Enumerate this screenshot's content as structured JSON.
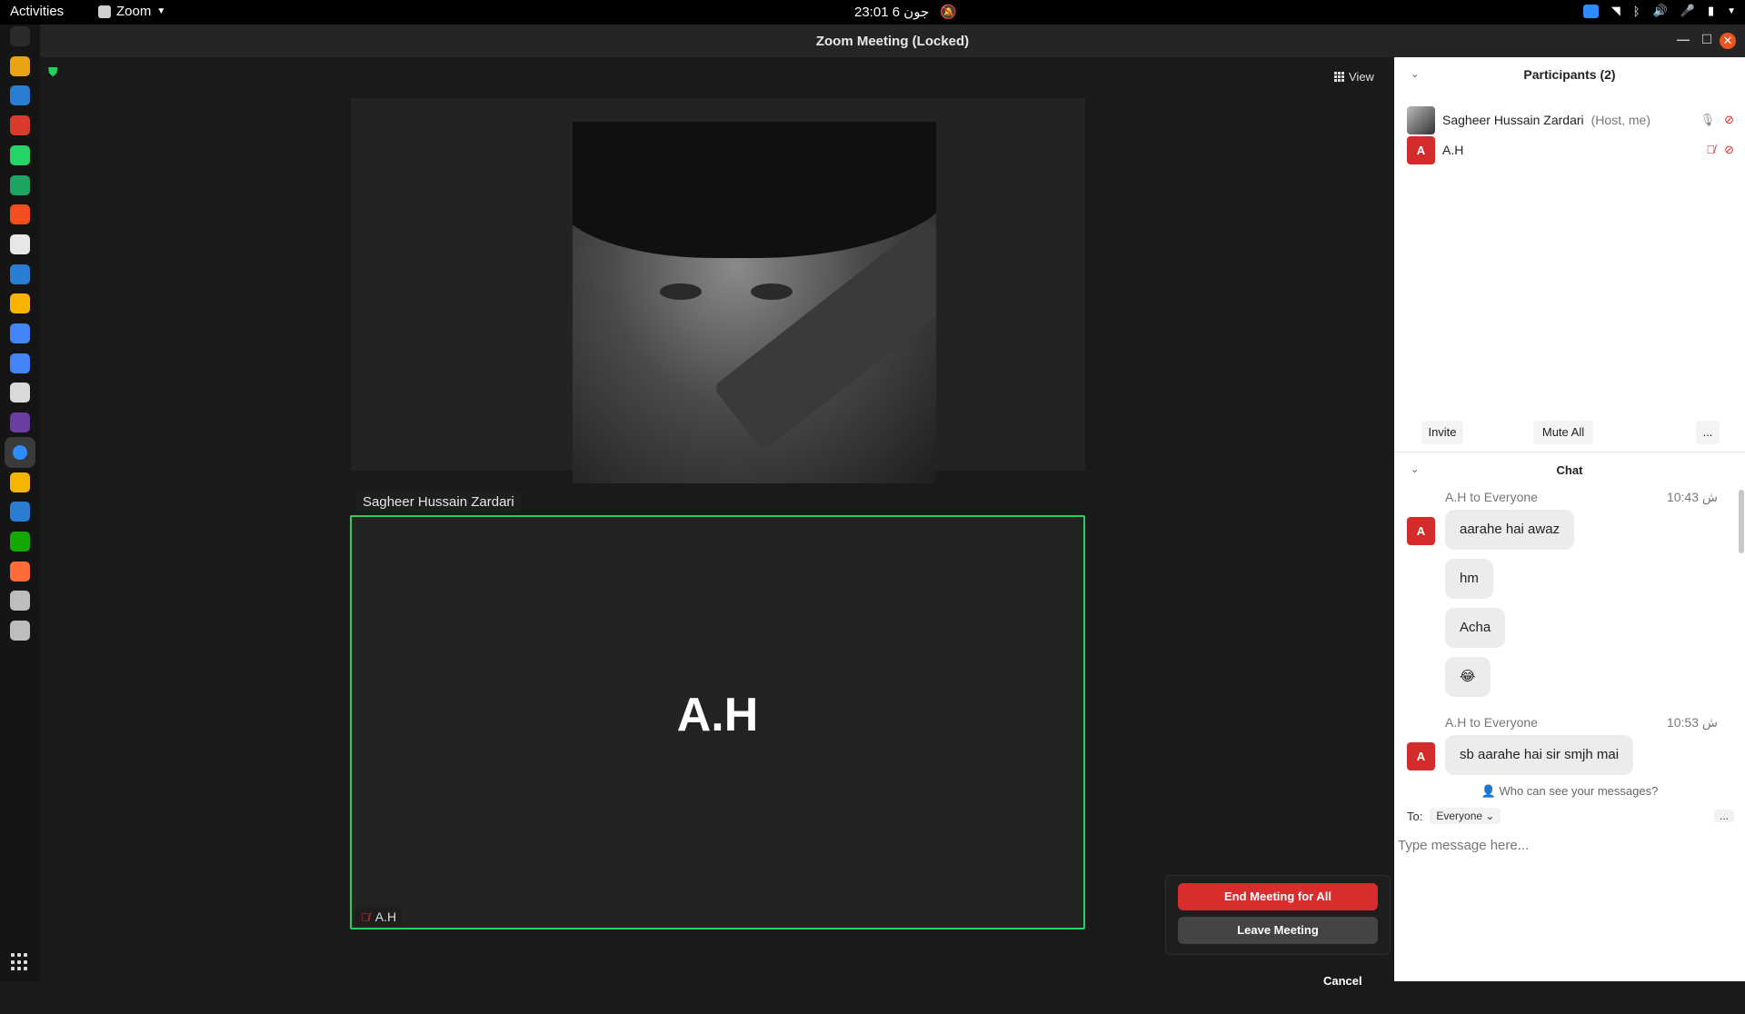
{
  "topbar": {
    "activities": "Activities",
    "app_name": "Zoom",
    "clock": "23:01  6 جون",
    "zoom_tray_icon": "zoom-tray-icon",
    "tray_icons": [
      "wifi-icon",
      "bluetooth-icon",
      "volume-icon",
      "mic-icon",
      "battery-icon",
      "chevron-down-icon"
    ]
  },
  "dock": {
    "apps": [
      {
        "name": "terminal",
        "color": "#2b2b2b"
      },
      {
        "name": "chrome",
        "color": "#e8a317"
      },
      {
        "name": "vscode",
        "color": "#2a7dd3"
      },
      {
        "name": "gmail",
        "color": "#d93b2b"
      },
      {
        "name": "whatsapp",
        "color": "#25d366"
      },
      {
        "name": "google-chat",
        "color": "#1ea362"
      },
      {
        "name": "figma",
        "color": "#f24e1e"
      },
      {
        "name": "github",
        "color": "#e8e8e8"
      },
      {
        "name": "trello",
        "color": "#2a7dd3"
      },
      {
        "name": "keep",
        "color": "#f6b400"
      },
      {
        "name": "docs",
        "color": "#4285f4"
      },
      {
        "name": "calendar",
        "color": "#4285f4"
      },
      {
        "name": "files",
        "color": "#d9d9d9"
      },
      {
        "name": "photos",
        "color": "#6a3ea1"
      },
      {
        "name": "zoom",
        "color": "#2d8cff"
      },
      {
        "name": "slides",
        "color": "#f4b400"
      },
      {
        "name": "writer",
        "color": "#2a7dd3"
      },
      {
        "name": "upwork",
        "color": "#14a800"
      },
      {
        "name": "postman",
        "color": "#ff6c37"
      },
      {
        "name": "drive",
        "color": "#bdbdbd"
      },
      {
        "name": "drive2",
        "color": "#bdbdbd"
      }
    ]
  },
  "window": {
    "title": "Zoom Meeting (Locked)",
    "view_label": "View",
    "tile_top_name": "Sagheer Hussain Zardari",
    "tile_bottom_big": "A.H",
    "tile_bottom_tag": "A.H",
    "end_meeting_label": "End Meeting for All",
    "leave_meeting_label": "Leave Meeting",
    "cancel_label": "Cancel",
    "accent_color": "#23d160",
    "end_color": "#d92c2c"
  },
  "participants": {
    "title": "Participants (2)",
    "list": [
      {
        "name": "Sagheer Hussain Zardari",
        "role": "(Host, me)",
        "avatar_letter": ""
      },
      {
        "name": "A.H",
        "role": "",
        "avatar_letter": "A"
      }
    ],
    "invite_label": "Invite",
    "mute_all_label": "Mute All",
    "more_label": "..."
  },
  "chat": {
    "title": "Chat",
    "messages": [
      {
        "from": "A.H to Everyone",
        "time": "10:43 ش",
        "avatar": "A",
        "texts": [
          "aarahe hai awaz",
          "hm",
          "Acha",
          "😂"
        ]
      },
      {
        "from": "A.H to Everyone",
        "time": "10:53 ش",
        "avatar": "A",
        "texts": [
          "sb aarahe hai sir smjh mai"
        ]
      }
    ],
    "who_can_see": "Who can see your messages?",
    "to_label": "To:",
    "to_value": "Everyone",
    "more_label": "...",
    "placeholder": "Type message here..."
  }
}
